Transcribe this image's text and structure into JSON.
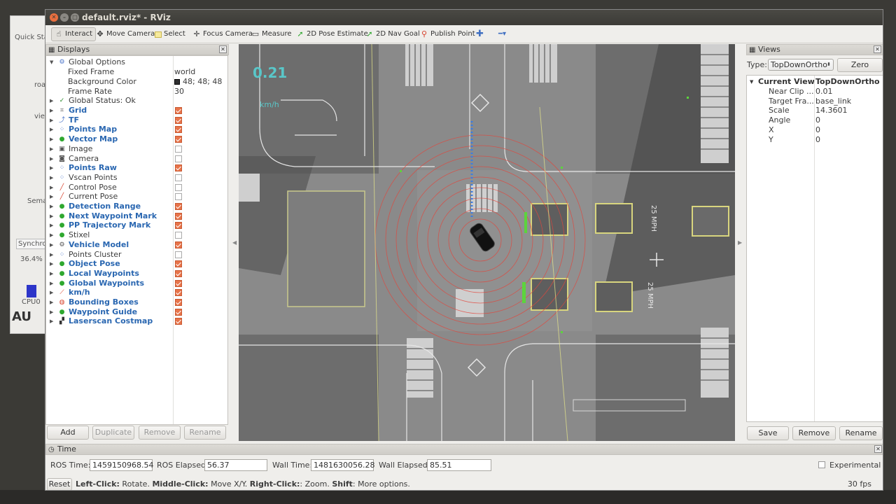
{
  "background_window": {
    "labels": [
      "Quick Sta",
      "roa",
      "vie",
      "Sema",
      "Synchron",
      "36.4%",
      "CPU0",
      "AU"
    ]
  },
  "window": {
    "title": "default.rviz* - RViz"
  },
  "toolbar": {
    "tools": [
      {
        "label": "Interact",
        "icon": "interact-icon",
        "active": true
      },
      {
        "label": "Move Camera",
        "icon": "move-camera-icon"
      },
      {
        "label": "Select",
        "icon": "select-icon"
      },
      {
        "label": "Focus Camera",
        "icon": "focus-camera-icon"
      },
      {
        "label": "Measure",
        "icon": "measure-icon"
      },
      {
        "label": "2D Pose Estimate",
        "icon": "pose-estimate-icon"
      },
      {
        "label": "2D Nav Goal",
        "icon": "nav-goal-icon"
      },
      {
        "label": "Publish Point",
        "icon": "publish-point-icon"
      }
    ]
  },
  "displays": {
    "title": "Displays",
    "global_options": {
      "label": "Global Options",
      "fixed_frame_label": "Fixed Frame",
      "fixed_frame": "world",
      "background_color_label": "Background Color",
      "background_color": "48; 48; 48",
      "frame_rate_label": "Frame Rate",
      "frame_rate": "30"
    },
    "global_status": "Global Status: Ok",
    "items": [
      {
        "name": "Grid",
        "checked": true,
        "blue": true,
        "icon": "grid-icon"
      },
      {
        "name": "TF",
        "checked": true,
        "blue": true,
        "icon": "tf-icon"
      },
      {
        "name": "Points Map",
        "checked": true,
        "blue": true,
        "icon": "points-icon"
      },
      {
        "name": "Vector Map",
        "checked": true,
        "blue": true,
        "icon": "marker-array-icon"
      },
      {
        "name": "Image",
        "checked": false,
        "blue": false,
        "icon": "image-icon"
      },
      {
        "name": "Camera",
        "checked": false,
        "blue": false,
        "icon": "camera-icon"
      },
      {
        "name": "Points Raw",
        "checked": true,
        "blue": true,
        "icon": "points-icon"
      },
      {
        "name": "Vscan Points",
        "checked": false,
        "blue": false,
        "icon": "points-icon"
      },
      {
        "name": "Control Pose",
        "checked": false,
        "blue": false,
        "icon": "pose-icon"
      },
      {
        "name": "Current Pose",
        "checked": false,
        "blue": false,
        "icon": "pose-icon"
      },
      {
        "name": "Detection Range",
        "checked": true,
        "blue": true,
        "icon": "marker-array-icon"
      },
      {
        "name": "Next Waypoint Mark",
        "checked": true,
        "blue": true,
        "icon": "marker-icon"
      },
      {
        "name": "PP Trajectory Mark",
        "checked": true,
        "blue": true,
        "icon": "marker-icon"
      },
      {
        "name": "Stixel",
        "checked": false,
        "blue": false,
        "icon": "marker-icon"
      },
      {
        "name": "Vehicle Model",
        "checked": true,
        "blue": true,
        "icon": "robot-model-icon"
      },
      {
        "name": "Points Cluster",
        "checked": false,
        "blue": false,
        "icon": "points-icon"
      },
      {
        "name": "Object Pose",
        "checked": true,
        "blue": true,
        "icon": "marker-array-icon"
      },
      {
        "name": "Local Waypoints",
        "checked": true,
        "blue": true,
        "icon": "marker-array-icon"
      },
      {
        "name": "Global Waypoints",
        "checked": true,
        "blue": true,
        "icon": "marker-array-icon"
      },
      {
        "name": "km/h",
        "checked": true,
        "blue": true,
        "icon": "chart-icon"
      },
      {
        "name": "Bounding Boxes",
        "checked": true,
        "blue": true,
        "icon": "bounding-box-icon"
      },
      {
        "name": "Waypoint Guide",
        "checked": true,
        "blue": true,
        "icon": "marker-icon"
      },
      {
        "name": "Laserscan Costmap",
        "checked": true,
        "blue": true,
        "icon": "map-icon"
      }
    ],
    "buttons": {
      "add": "Add",
      "duplicate": "Duplicate",
      "remove": "Remove",
      "rename": "Rename"
    }
  },
  "viewport": {
    "speed_value": "0.21",
    "speed_unit": "km/h",
    "road_labels": [
      "25 MPH",
      "25 MPH"
    ]
  },
  "views": {
    "title": "Views",
    "type_label": "Type:",
    "type_value": "TopDownOrtho",
    "zero_label": "Zero",
    "current_view_label": "Current View",
    "current_view_value": "TopDownOrtho ...",
    "props": [
      {
        "name": "Near Clip ...",
        "value": "0.01"
      },
      {
        "name": "Target Fra...",
        "value": "base_link"
      },
      {
        "name": "Scale",
        "value": "14.3601"
      },
      {
        "name": "Angle",
        "value": "0"
      },
      {
        "name": "X",
        "value": "0"
      },
      {
        "name": "Y",
        "value": "0"
      }
    ],
    "buttons": {
      "save": "Save",
      "remove": "Remove",
      "rename": "Rename"
    }
  },
  "time": {
    "title": "Time",
    "ros_time_label": "ROS Time:",
    "ros_time": "1459150968.54",
    "ros_elapsed_label": "ROS Elapsed:",
    "ros_elapsed": "56.37",
    "wall_time_label": "Wall Time:",
    "wall_time": "1481630056.28",
    "wall_elapsed_label": "Wall Elapsed:",
    "wall_elapsed": "85.51",
    "experimental_label": "Experimental"
  },
  "status": {
    "reset_label": "Reset",
    "hint_left_click": "Left-Click:",
    "hint_left_action": " Rotate. ",
    "hint_middle_click": "Middle-Click:",
    "hint_middle_action": " Move X/Y. ",
    "hint_right_click": "Right-Click:",
    "hint_right_action": ": Zoom. ",
    "hint_shift": "Shift",
    "hint_shift_action": ": More options.",
    "fps": "30 fps"
  },
  "colors": {
    "accent_check": "#e8744a",
    "display_blue": "#2a67b1",
    "titlebar": "#3c3b37"
  }
}
